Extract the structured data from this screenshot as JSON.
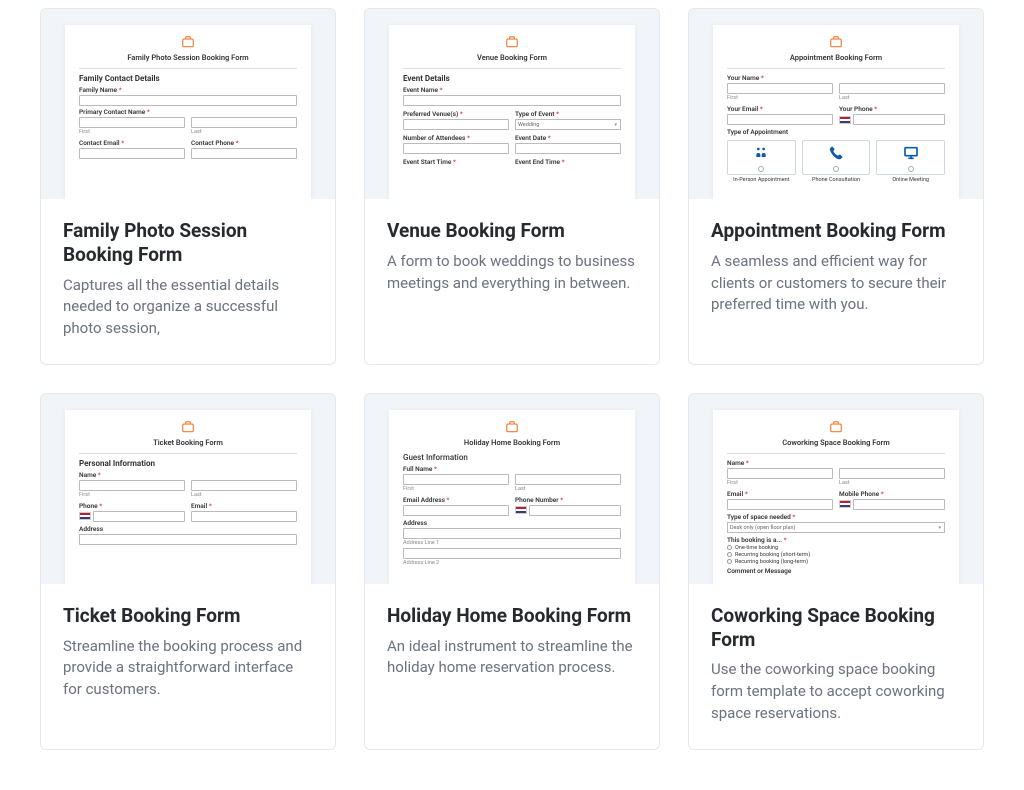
{
  "cards": [
    {
      "title": "Family Photo Session Booking Form",
      "desc": "Captures all the essential details needed to organize a successful photo session,",
      "thumb": {
        "form_title": "Family Photo Session Booking Form",
        "section": "Family Contact Details",
        "fields": {
          "family_name": "Family Name",
          "primary_contact": "Primary Contact Name",
          "first": "First",
          "last": "Last",
          "contact_email": "Contact Email",
          "contact_phone": "Contact Phone"
        }
      }
    },
    {
      "title": "Venue Booking Form",
      "desc": "A form to book weddings to business meetings and everything in between.",
      "thumb": {
        "form_title": "Venue Booking Form",
        "section": "Event Details",
        "fields": {
          "event_name": "Event Name",
          "preferred_venues": "Preferred Venue(s)",
          "type_of_event": "Type of Event",
          "type_value": "Wedding",
          "attendees": "Number of Attendees",
          "event_date": "Event Date",
          "start": "Event Start Time",
          "end": "Event End Time"
        }
      }
    },
    {
      "title": "Appointment Booking Form",
      "desc": "A seamless and efficient way for clients or customers to secure their preferred time with you.",
      "thumb": {
        "form_title": "Appointment Booking Form",
        "fields": {
          "your_name": "Your Name",
          "first": "First",
          "last": "Last",
          "your_email": "Your Email",
          "your_phone": "Your Phone",
          "type_of_appt": "Type of Appointment",
          "in_person": "In-Person Appointment",
          "phone_consult": "Phone Consultation",
          "online_meeting": "Online Meeting"
        }
      }
    },
    {
      "title": "Ticket Booking Form",
      "desc": "Streamline the booking process and provide a straightforward interface for customers.",
      "thumb": {
        "form_title": "Ticket Booking Form",
        "section": "Personal Information",
        "fields": {
          "name": "Name",
          "first": "First",
          "last": "Last",
          "phone": "Phone",
          "email": "Email",
          "address": "Address"
        }
      }
    },
    {
      "title": "Holiday Home Booking Form",
      "desc": "An ideal instrument to streamline the holiday home reservation process.",
      "thumb": {
        "form_title": "Holiday Home Booking Form",
        "section": "Guest Information",
        "fields": {
          "full_name": "Full Name",
          "first": "First",
          "last": "Last",
          "email_addr": "Email Address",
          "phone_number": "Phone Number",
          "address": "Address",
          "line1": "Address Line 1",
          "line2": "Address Line 2"
        }
      }
    },
    {
      "title": "Coworking Space Booking Form",
      "desc": "Use the coworking space booking form template to accept coworking space reservations.",
      "thumb": {
        "form_title": "Coworking Space Booking Form",
        "fields": {
          "name": "Name",
          "first": "First",
          "last": "Last",
          "email": "Email",
          "mobile": "Mobile Phone",
          "type_space": "Type of space needed",
          "type_space_value": "Desk only (open floor plan)",
          "booking_is": "This booking is a...",
          "one_time": "One-time booking",
          "recurring_short": "Recurring booking (short-term)",
          "recurring_long": "Recurring booking (long-term)",
          "comment": "Comment or Message"
        }
      }
    }
  ]
}
